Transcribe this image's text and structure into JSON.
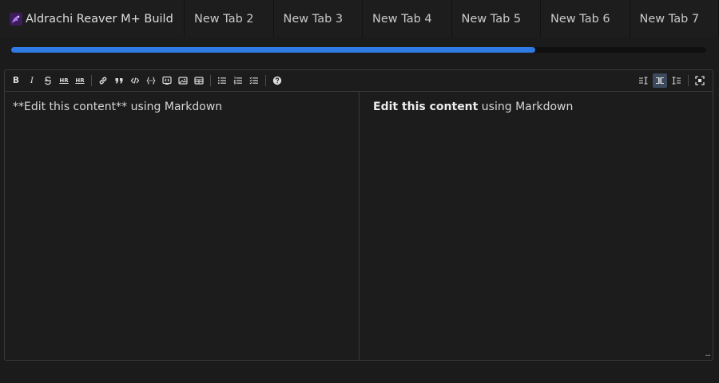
{
  "tabs": [
    {
      "label": "Aldrachi Reaver M+ Build",
      "icon": "demon-hunter-icon"
    },
    {
      "label": "New Tab 2"
    },
    {
      "label": "New Tab 3"
    },
    {
      "label": "New Tab 4"
    },
    {
      "label": "New Tab 5"
    },
    {
      "label": "New Tab 6"
    },
    {
      "label": "New Tab 7"
    }
  ],
  "progress": {
    "fraction": 0.754,
    "color": "#2f7ae5"
  },
  "toolbar": {
    "bold": "B",
    "italic": "I",
    "heading": "HR",
    "subheading": "HR",
    "tools_left": [
      "bold-icon",
      "italic-icon",
      "strikethrough-icon",
      "heading-icon",
      "heading-alt-icon",
      "link-icon",
      "quote-icon",
      "code-icon",
      "code-block-icon",
      "embed-icon",
      "image-icon",
      "table-icon",
      "bulleted-list-icon",
      "numbered-list-icon",
      "checklist-icon",
      "help-icon"
    ],
    "tools_right": [
      "edit-only-view-icon",
      "split-view-icon",
      "preview-only-view-icon",
      "fullscreen-icon"
    ]
  },
  "editor": {
    "source_text": "**Edit this content** using Markdown",
    "preview_bold": "Edit this content",
    "preview_rest": " using Markdown",
    "resize_glyph": "..."
  },
  "colors": {
    "accent": "#2f7ae5",
    "background": "#1b1b1b",
    "active_view": "#3d4a5e"
  }
}
